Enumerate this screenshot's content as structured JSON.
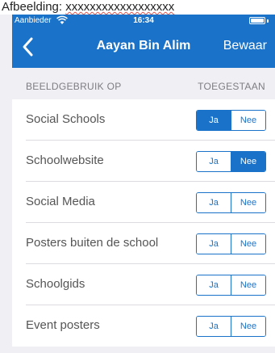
{
  "caption": {
    "text": "Afbeelding: ",
    "squiggle_text": "xxxxxxxxxxxxxxxxxx"
  },
  "status_bar": {
    "carrier": "Aanbieder",
    "time": "16:34"
  },
  "nav": {
    "title": "Aayan Bin Alim",
    "save_label": "Bewaar"
  },
  "section": {
    "left_label": "BEELDGEBRUIK OP",
    "right_label": "TOEGESTAAN"
  },
  "rows": [
    {
      "label": "Social Schools",
      "yes": "Ja",
      "no": "Nee",
      "selected": "yes"
    },
    {
      "label": "Schoolwebsite",
      "yes": "Ja",
      "no": "Nee",
      "selected": "no"
    },
    {
      "label": "Social Media",
      "yes": "Ja",
      "no": "Nee",
      "selected": "none"
    },
    {
      "label": "Posters buiten de school",
      "yes": "Ja",
      "no": "Nee",
      "selected": "none"
    },
    {
      "label": "Schoolgids",
      "yes": "Ja",
      "no": "Nee",
      "selected": "none"
    },
    {
      "label": "Event posters",
      "yes": "Ja",
      "no": "Nee",
      "selected": "none"
    }
  ],
  "colors": {
    "accent": "#1a73c8",
    "background": "#efeff4"
  },
  "icons": {
    "back": "chevron-left-icon",
    "wifi": "wifi-icon",
    "battery": "battery-icon"
  }
}
